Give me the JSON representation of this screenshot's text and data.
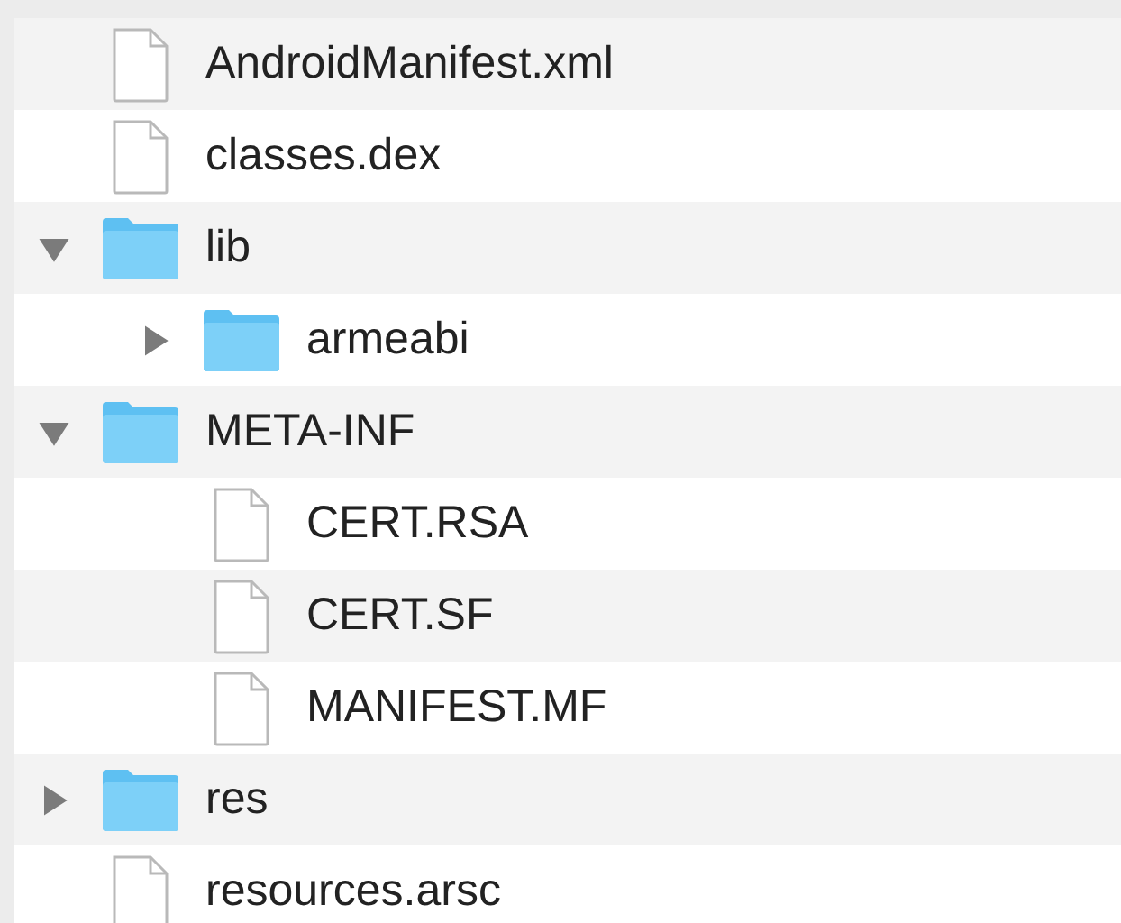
{
  "file_list": {
    "items": [
      {
        "kind": "file",
        "name": "AndroidManifest.xml"
      },
      {
        "kind": "file",
        "name": "classes.dex"
      },
      {
        "kind": "folder",
        "name": "lib",
        "expanded": true,
        "children": [
          {
            "kind": "folder",
            "name": "armeabi",
            "expanded": false
          }
        ]
      },
      {
        "kind": "folder",
        "name": "META-INF",
        "expanded": true,
        "children": [
          {
            "kind": "file",
            "name": "CERT.RSA"
          },
          {
            "kind": "file",
            "name": "CERT.SF"
          },
          {
            "kind": "file",
            "name": "MANIFEST.MF"
          }
        ]
      },
      {
        "kind": "folder",
        "name": "res",
        "expanded": false
      },
      {
        "kind": "file",
        "name": "resources.arsc"
      }
    ]
  }
}
